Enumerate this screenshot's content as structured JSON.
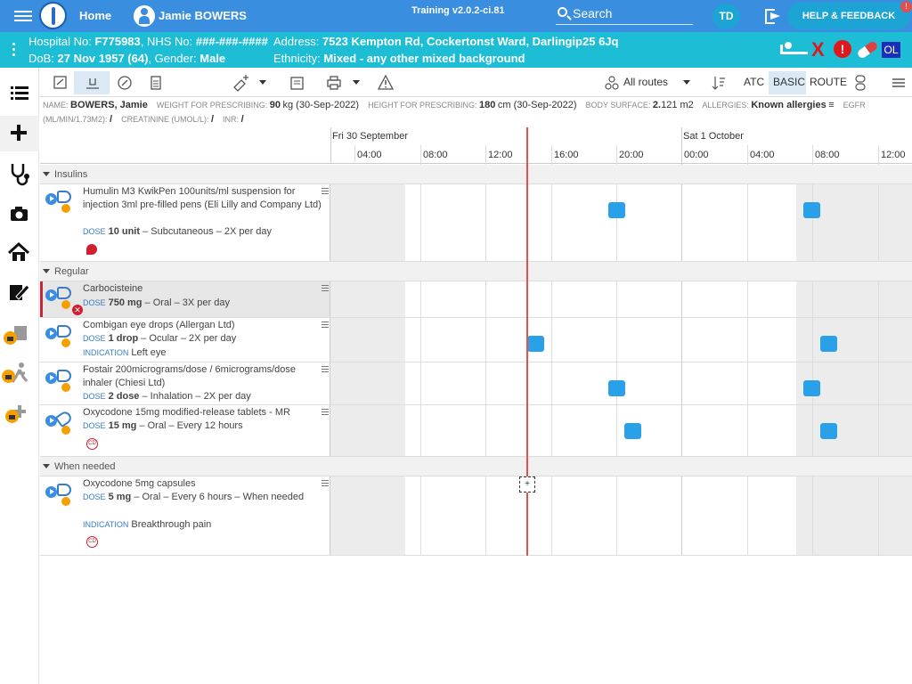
{
  "header": {
    "home_label": "Home",
    "patient_name": "Jamie BOWERS",
    "version": "Training v2.0.2-ci.81",
    "search_label": "Search",
    "user_initials": "TD",
    "help_label": "HELP & FEEDBACK",
    "notification_count": "!"
  },
  "banner": {
    "hospital_label": "Hospital No:",
    "hospital_no": "F775983",
    "nhs_label": ", NHS No:",
    "nhs_no": "###-###-####",
    "dob_label": "DoB:",
    "dob": "27 Nov 1957 (64)",
    "gender_label": ", Gender:",
    "gender": "Male",
    "address_label": "Address:",
    "address": "7523 Kempton Rd, Cockertonst Ward, Darlingip25 6Jq",
    "ethnicity_label": "Ethnicity:",
    "ethnicity": "Mixed - any other mixed background",
    "badge_ol": "OL",
    "badge_x": "X",
    "badge_alert": "!"
  },
  "toolbar": {
    "routes_label": "All routes",
    "atc": "ATC",
    "basic": "BASIC",
    "route": "ROUTE"
  },
  "infobar": {
    "name_label": "NAME:",
    "name": "BOWERS, Jamie",
    "weight_label": "WEIGHT FOR PRESCRIBING:",
    "weight": "90",
    "weight_unit": "kg (30-Sep-2022)",
    "height_label": "HEIGHT FOR PRESCRIBING:",
    "height": "180",
    "height_unit": "cm (30-Sep-2022)",
    "bsa_label": "BODY SURFACE:",
    "bsa": "2.",
    "bsa_rest": "121 m2",
    "allergies_label": "ALLERGIES:",
    "allergies": "Known allergies",
    "egfr_label": "EGFR",
    "egfr_unit": "(ML/MIN/1.73M2):",
    "egfr": "/",
    "creat_label": "CREATININE (UMOL/L):",
    "creat": "/",
    "inr_label": "INR:",
    "inr": "/"
  },
  "timeline": {
    "day1": "Fri 30 September",
    "day2": "Sat 1 October",
    "hours": [
      "04:00",
      "08:00",
      "12:00",
      "16:00",
      "20:00",
      "00:00",
      "04:00",
      "08:00",
      "12:00"
    ]
  },
  "sections": {
    "insulins": "Insulins",
    "regular": "Regular",
    "when_needed": "When needed"
  },
  "meds": {
    "humulin": {
      "name": "Humulin M3 KwikPen 100units/ml suspension for injection 3ml pre-filled pens (Eli Lilly and Company Ltd)",
      "dose_label": "DOSE",
      "dose": "10 unit",
      "detail": " – Subcutaneous – 2X per day"
    },
    "carbocisteine": {
      "name": "Carbocisteine",
      "dose_label": "DOSE",
      "dose": "750 mg",
      "detail": " – Oral – 3X per day",
      "stop_mark": "✕"
    },
    "combigan": {
      "name": "Combigan eye drops (Allergan Ltd)",
      "dose_label": "DOSE",
      "dose": "1 drop",
      "detail": " – Ocular – 2X per day",
      "ind_label": "INDICATION",
      "indication": "Left eye"
    },
    "fostair": {
      "name": "Fostair 200micrograms/dose / 6micrograms/dose inhaler (Chiesi Ltd)",
      "dose_label": "DOSE",
      "dose": "2 dose",
      "detail": " – Inhalation – 2X per day"
    },
    "oxy_mr": {
      "name": "Oxycodone 15mg modified-release tablets - MR",
      "dose_label": "DOSE",
      "dose": "15 mg",
      "detail": " – Oral – Every 12 hours",
      "cd": "CD"
    },
    "oxy_caps": {
      "name": "Oxycodone 5mg capsules",
      "dose_label": "DOSE",
      "dose": "5 mg",
      "detail": " – Oral – Every 6 hours – When needed",
      "ind_label": "INDICATION",
      "indication": "Breakthrough pain",
      "cd": "CD"
    }
  },
  "add_button": "+"
}
